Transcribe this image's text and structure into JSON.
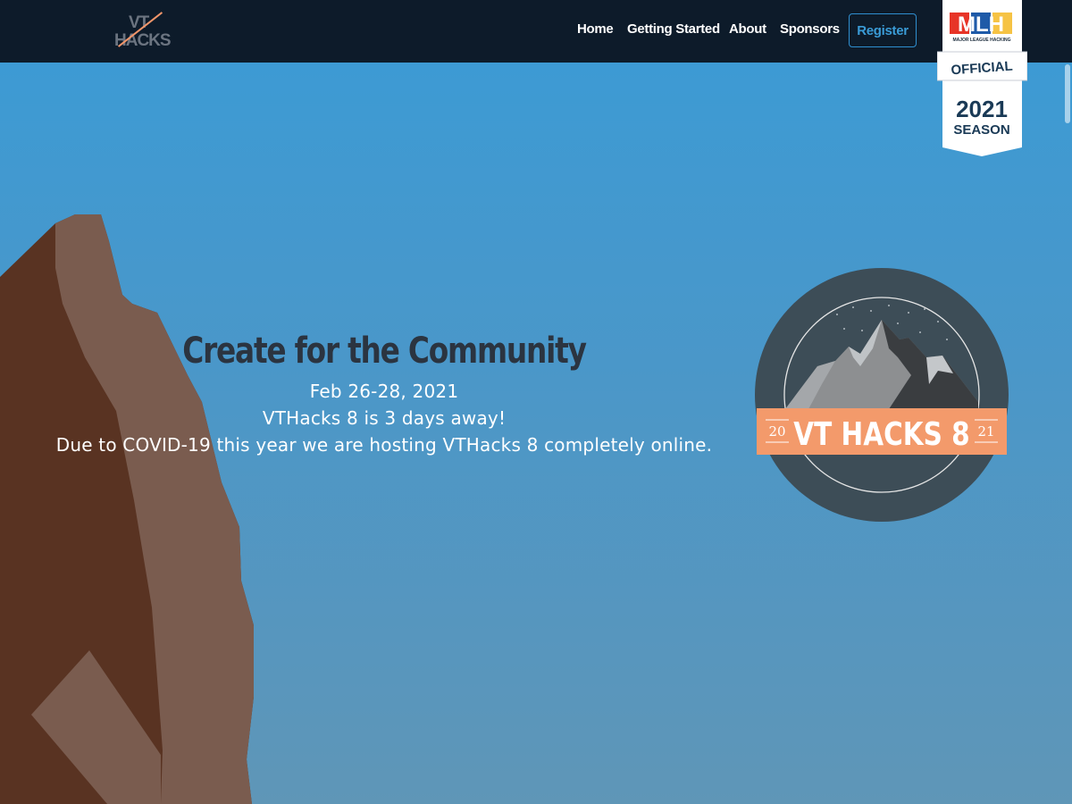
{
  "nav": {
    "logo_line1": "VT",
    "logo_line2": "HACKS",
    "links": [
      "Home",
      "Getting Started",
      "About",
      "Sponsors"
    ],
    "register": "Register"
  },
  "mlh_badge": {
    "brand": "MLH",
    "brand_sub": "MAJOR LEAGUE HACKING",
    "official": "OFFICIAL",
    "year": "2021",
    "season": "SEASON"
  },
  "hero": {
    "title": "Create for the Community",
    "date": "Feb 26-28, 2021",
    "countdown": "VTHacks 8 is 3 days away!",
    "notice": "Due to COVID-19 this year we are hosting VTHacks 8 completely online."
  },
  "emblem": {
    "title": "VT HACKS 8",
    "year_left": "20",
    "year_right": "21"
  },
  "colors": {
    "nav_bg": "#0d1b2a",
    "sky_top": "#3a9bd6",
    "accent_orange": "#f39a6b",
    "rock_dark": "#593322",
    "rock_light": "#7a5c4f",
    "emblem_bg": "#3d4d57"
  }
}
